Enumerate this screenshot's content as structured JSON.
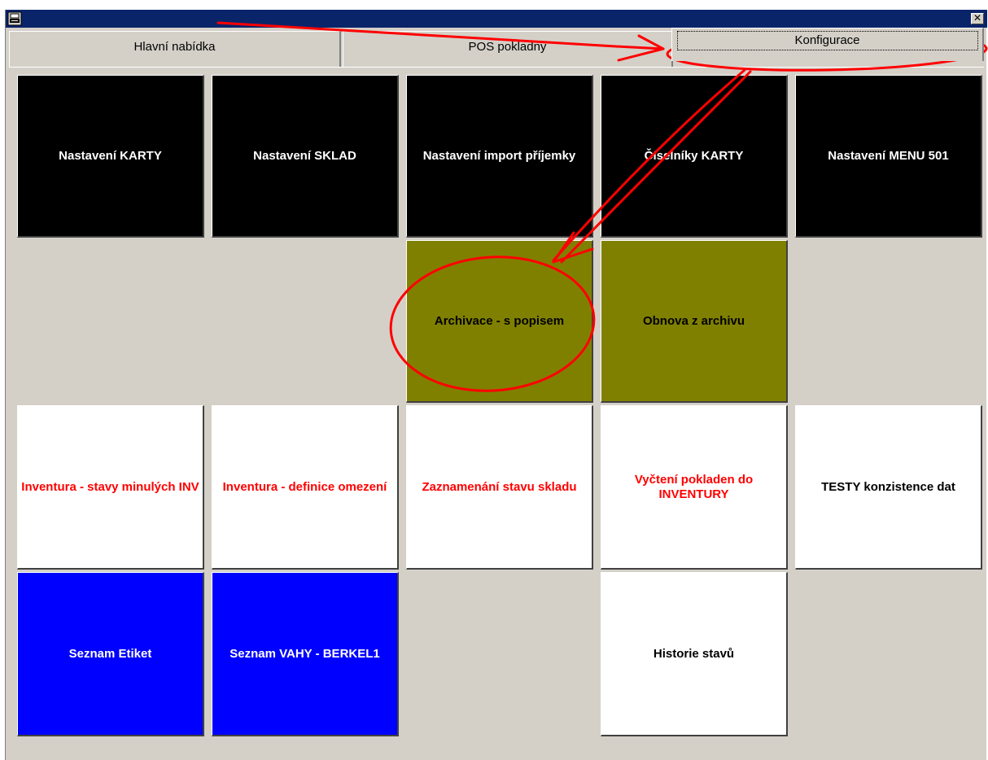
{
  "window": {
    "close_glyph": "✕"
  },
  "tabs": [
    {
      "label": "Hlavní nabídka"
    },
    {
      "label": "POS pokladny"
    },
    {
      "label": "Konfigurace"
    }
  ],
  "tiles": {
    "r1": [
      "Nastavení KARTY",
      "Nastavení SKLAD",
      "Nastavení import příjemky",
      "Číselníky KARTY",
      "Nastavení MENU 501"
    ],
    "r2": [
      "Archivace - s popisem",
      "Obnova z archivu"
    ],
    "r3": [
      "Inventura - stavy minulých INV",
      "Inventura - definice omezení",
      "Zaznamenání stavu skladu",
      "Vyčtení pokladen do INVENTURY",
      "TESTY konzistence dat"
    ],
    "r4": [
      "Seznam Etiket",
      "Seznam VAHY - BERKEL1",
      "Historie stavů"
    ]
  },
  "colors": {
    "titlebar": "#0a246a",
    "tile_black": "#000000",
    "tile_olive": "#808000",
    "tile_white": "#ffffff",
    "tile_blue": "#0000ff",
    "text_red": "#ff0000",
    "annotation": "#ff0000"
  }
}
